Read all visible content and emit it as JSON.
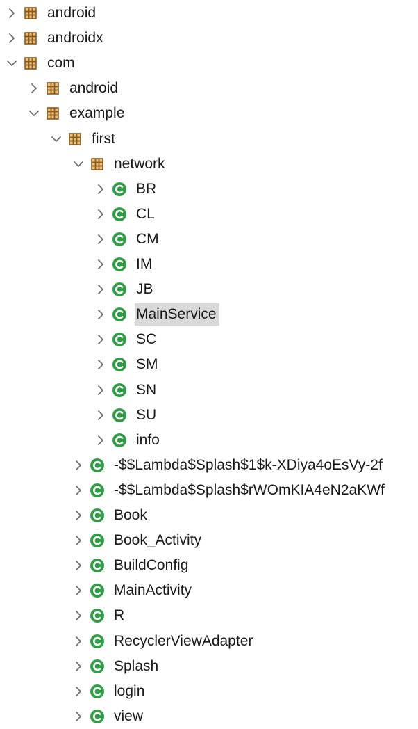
{
  "tree": [
    {
      "label": "android",
      "type": "package",
      "depth": 0,
      "expanded": false
    },
    {
      "label": "androidx",
      "type": "package",
      "depth": 0,
      "expanded": false
    },
    {
      "label": "com",
      "type": "package",
      "depth": 0,
      "expanded": true
    },
    {
      "label": "android",
      "type": "package",
      "depth": 1,
      "expanded": false
    },
    {
      "label": "example",
      "type": "package",
      "depth": 1,
      "expanded": true
    },
    {
      "label": "first",
      "type": "package",
      "depth": 2,
      "expanded": true
    },
    {
      "label": "network",
      "type": "package",
      "depth": 3,
      "expanded": true
    },
    {
      "label": "BR",
      "type": "class",
      "depth": 4,
      "expanded": false
    },
    {
      "label": "CL",
      "type": "class",
      "depth": 4,
      "expanded": false
    },
    {
      "label": "CM",
      "type": "class",
      "depth": 4,
      "expanded": false
    },
    {
      "label": "IM",
      "type": "class",
      "depth": 4,
      "expanded": false
    },
    {
      "label": "JB",
      "type": "class",
      "depth": 4,
      "expanded": false
    },
    {
      "label": "MainService",
      "type": "class",
      "depth": 4,
      "expanded": false,
      "selected": true
    },
    {
      "label": "SC",
      "type": "class",
      "depth": 4,
      "expanded": false
    },
    {
      "label": "SM",
      "type": "class",
      "depth": 4,
      "expanded": false
    },
    {
      "label": "SN",
      "type": "class",
      "depth": 4,
      "expanded": false
    },
    {
      "label": "SU",
      "type": "class",
      "depth": 4,
      "expanded": false
    },
    {
      "label": "info",
      "type": "class",
      "depth": 4,
      "expanded": false
    },
    {
      "label": "-$$Lambda$Splash$1$k-XDiya4oEsVy-2f",
      "type": "class",
      "depth": 3,
      "expanded": false
    },
    {
      "label": "-$$Lambda$Splash$rWOmKIA4eN2aKWf",
      "type": "class",
      "depth": 3,
      "expanded": false
    },
    {
      "label": "Book",
      "type": "class",
      "depth": 3,
      "expanded": false
    },
    {
      "label": "Book_Activity",
      "type": "class",
      "depth": 3,
      "expanded": false
    },
    {
      "label": "BuildConfig",
      "type": "class",
      "depth": 3,
      "expanded": false
    },
    {
      "label": "MainActivity",
      "type": "class",
      "depth": 3,
      "expanded": false
    },
    {
      "label": "R",
      "type": "class",
      "depth": 3,
      "expanded": false
    },
    {
      "label": "RecyclerViewAdapter",
      "type": "class",
      "depth": 3,
      "expanded": false
    },
    {
      "label": "Splash",
      "type": "class",
      "depth": 3,
      "expanded": false
    },
    {
      "label": "login",
      "type": "class",
      "depth": 3,
      "expanded": false
    },
    {
      "label": "view",
      "type": "class",
      "depth": 3,
      "expanded": false
    }
  ],
  "icons": {
    "package": "package-icon",
    "class": "class-icon"
  },
  "colors": {
    "package_brown": "#8b5a1e",
    "package_fill": "#e9c27a",
    "class_green": "#2e9d46",
    "chevron": "#6f6f6f",
    "selection": "#d9d9d9"
  }
}
